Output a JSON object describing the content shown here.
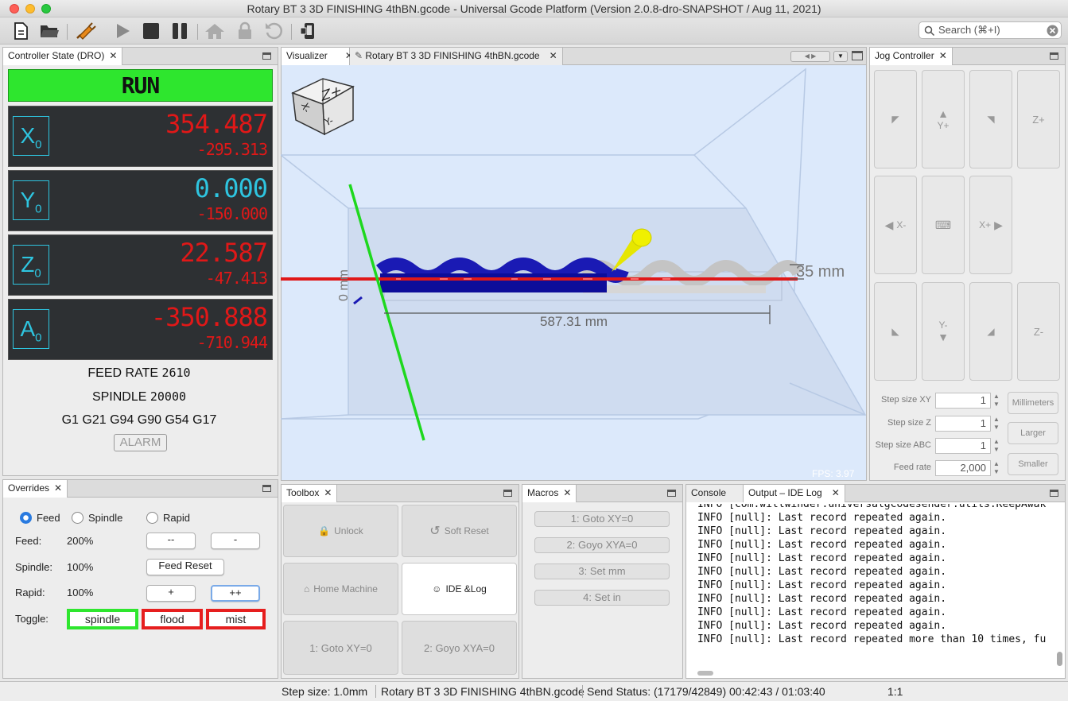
{
  "window": {
    "title": "Rotary BT 3 3D FINISHING 4thBN.gcode - Universal Gcode Platform (Version 2.0.8-dro-SNAPSHOT / Aug 11, 2021)"
  },
  "search": {
    "placeholder": "Search (⌘+I)"
  },
  "dro": {
    "tab": "Controller State (DRO)",
    "state": "RUN",
    "axes": [
      {
        "name": "X",
        "sub": "0",
        "work": "354.487",
        "machine": "-295.313",
        "color": "#e01818"
      },
      {
        "name": "Y",
        "sub": "0",
        "work": "0.000",
        "machine": "-150.000",
        "color": "#2ec5e0"
      },
      {
        "name": "Z",
        "sub": "0",
        "work": "22.587",
        "machine": "-47.413",
        "color": "#e01818"
      },
      {
        "name": "A",
        "sub": "0",
        "work": "-350.888",
        "machine": "-710.944",
        "color": "#e01818"
      }
    ],
    "feed_label": "FEED RATE",
    "feed_value": "2610",
    "spindle_label": "SPINDLE",
    "spindle_value": "20000",
    "gcodes": "G1 G21 G94 G90 G54 G17",
    "alarm": "ALARM"
  },
  "overrides": {
    "tab": "Overrides",
    "radios": [
      "Feed",
      "Spindle",
      "Rapid"
    ],
    "feed_label": "Feed:",
    "feed_value": "200%",
    "spindle_label": "Spindle:",
    "spindle_value": "100%",
    "rapid_label": "Rapid:",
    "rapid_value": "100%",
    "btn_mm": "--",
    "btn_m": "-",
    "btn_reset": "Feed Reset",
    "btn_p": "+",
    "btn_pp": "++",
    "toggle_label": "Toggle:",
    "toggles": [
      "spindle",
      "flood",
      "mist"
    ]
  },
  "visualizer": {
    "tab1": "Visualizer",
    "tab2": "Rotary BT 3 3D FINISHING 4thBN.gcode",
    "cube_top": "Z+",
    "cube_x": "X-",
    "cube_y": "Y-",
    "dim_x": "587.31 mm",
    "dim_y": "35 mm",
    "dim_z": "0 mm",
    "fps": "FPS: 3.97"
  },
  "toolbox": {
    "tab": "Toolbox",
    "buttons": [
      "Unlock",
      "Soft Reset",
      "Home Machine",
      "IDE &Log",
      "1: Goto XY=0",
      "2: Goyo XYA=0"
    ]
  },
  "macros": {
    "tab": "Macros",
    "items": [
      "1: Goto XY=0",
      "2: Goyo XYA=0",
      "3: Set mm",
      "4: Set in"
    ]
  },
  "console": {
    "tab1": "Console",
    "tab2": "Output – IDE Log",
    "lines": [
      "INFO [com.willwinder.universalgcodesender.utils.KeepAwak",
      "INFO [null]: Last record repeated again.",
      "INFO [null]: Last record repeated again.",
      "INFO [null]: Last record repeated again.",
      "INFO [null]: Last record repeated again.",
      "INFO [null]: Last record repeated again.",
      "INFO [null]: Last record repeated again.",
      "INFO [null]: Last record repeated again.",
      "INFO [null]: Last record repeated again.",
      "INFO [null]: Last record repeated again.",
      "INFO [null]: Last record repeated more than 10 times, fu"
    ]
  },
  "jog": {
    "tab": "Jog Controller",
    "yplus": "Y+",
    "zplus": "Z+",
    "xminus": "X-",
    "xplus": "X+",
    "yminus": "Y-",
    "zminus": "Z-",
    "step_xy_label": "Step size XY",
    "step_xy": "1",
    "step_z_label": "Step size Z",
    "step_z": "1",
    "step_abc_label": "Step size ABC",
    "step_abc": "1",
    "feed_label": "Feed rate",
    "feed": "2,000",
    "units": "Millimeters",
    "larger": "Larger",
    "smaller": "Smaller"
  },
  "status": {
    "step": "Step size: 1.0mm",
    "file": "Rotary BT 3 3D FINISHING 4thBN.gcode",
    "send": "Send Status: (17179/42849) 00:42:43 / 01:03:40",
    "ratio": "1:1"
  }
}
